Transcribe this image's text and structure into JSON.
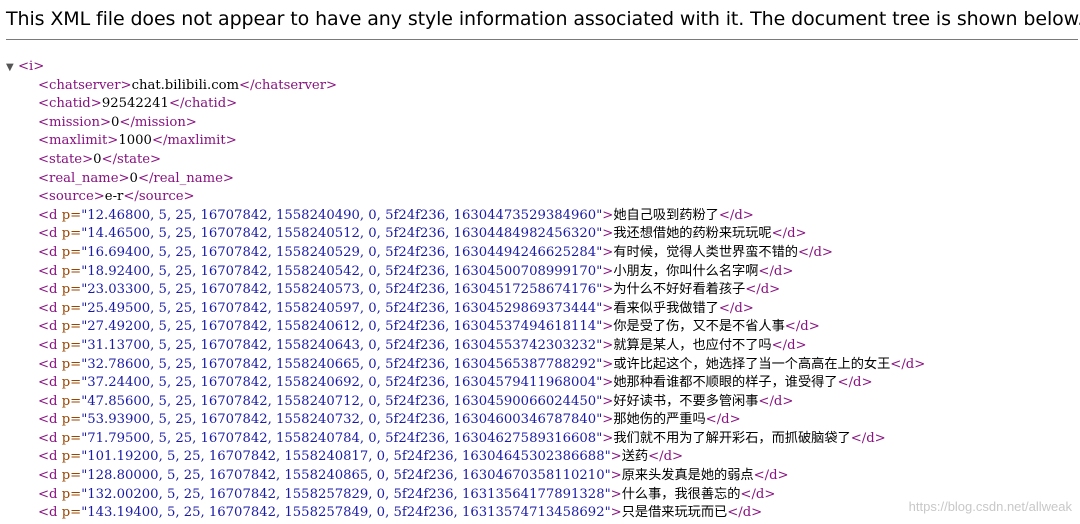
{
  "banner": "This XML file does not appear to have any style information associated with it. The document tree is shown below.",
  "root": {
    "open": "<i>",
    "toggle": "▼"
  },
  "elements": [
    {
      "tag": "chatserver",
      "text": "chat.bilibili.com"
    },
    {
      "tag": "chatid",
      "text": "92542241"
    },
    {
      "tag": "mission",
      "text": "0"
    },
    {
      "tag": "maxlimit",
      "text": "1000"
    },
    {
      "tag": "state",
      "text": "0"
    },
    {
      "tag": "real_name",
      "text": "0"
    },
    {
      "tag": "source",
      "text": "e-r"
    }
  ],
  "danmaku": [
    {
      "p": "12.46800,5,25,16707842,1558240490,0,5f24f236,16304473529384960",
      "text": "她自己吸到药粉了"
    },
    {
      "p": "14.46500,5,25,16707842,1558240512,0,5f24f236,16304484982456320",
      "text": "我还想借她的药粉来玩玩呢"
    },
    {
      "p": "16.69400,5,25,16707842,1558240529,0,5f24f236,16304494246625284",
      "text": "有时候，觉得人类世界蛮不错的"
    },
    {
      "p": "18.92400,5,25,16707842,1558240542,0,5f24f236,16304500708999170",
      "text": "小朋友，你叫什么名字啊"
    },
    {
      "p": "23.03300,5,25,16707842,1558240573,0,5f24f236,16304517258674176",
      "text": "为什么不好好看着孩子"
    },
    {
      "p": "25.49500,5,25,16707842,1558240597,0,5f24f236,16304529869373444",
      "text": "看来似乎我做错了"
    },
    {
      "p": "27.49200,5,25,16707842,1558240612,0,5f24f236,16304537494618114",
      "text": "你是受了伤，又不是不省人事"
    },
    {
      "p": "31.13700,5,25,16707842,1558240643,0,5f24f236,16304553742303232",
      "text": "就算是某人，也应付不了吗"
    },
    {
      "p": "32.78600,5,25,16707842,1558240665,0,5f24f236,16304565387788292",
      "text": "或许比起这个，她选择了当一个高高在上的女王"
    },
    {
      "p": "37.24400,5,25,16707842,1558240692,0,5f24f236,16304579411968004",
      "text": "她那种看谁都不顺眼的样子，谁受得了"
    },
    {
      "p": "47.85600,5,25,16707842,1558240712,0,5f24f236,16304590066024450",
      "text": "好好读书，不要多管闲事"
    },
    {
      "p": "53.93900,5,25,16707842,1558240732,0,5f24f236,16304600346787840",
      "text": "那她伤的严重吗"
    },
    {
      "p": "71.79500,5,25,16707842,1558240784,0,5f24f236,16304627589316608",
      "text": "我们就不用为了解开彩石，而抓破脑袋了"
    },
    {
      "p": "101.19200,5,25,16707842,1558240817,0,5f24f236,16304645302386688",
      "text": "送药"
    },
    {
      "p": "128.80000,5,25,16707842,1558240865,0,5f24f236,16304670358110210",
      "text": "原来头发真是她的弱点"
    },
    {
      "p": "132.00200,5,25,16707842,1558257829,0,5f24f236,16313564177891328",
      "text": "什么事，我很善忘的"
    },
    {
      "p": "143.19400,5,25,16707842,1558257849,0,5f24f236,16313574713458692",
      "text": "只是借来玩玩而已"
    }
  ],
  "watermark": "https://blog.csdn.net/allweak"
}
